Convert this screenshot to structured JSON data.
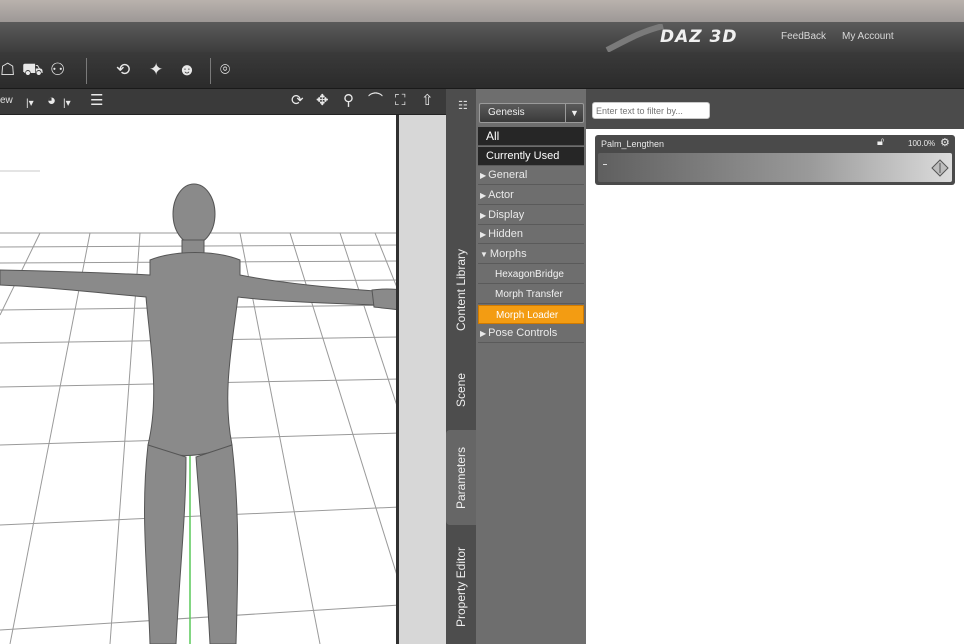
{
  "brand": {
    "logo": "DAZ 3D",
    "links": [
      "FeedBack",
      "My Account"
    ]
  },
  "viewport": {
    "view_label": "ew"
  },
  "side_tabs": [
    "Content Library",
    "Scene",
    "Parameters",
    "Property Editor"
  ],
  "active_side_tab": "Parameters",
  "figure_select": {
    "value": "Genesis",
    "arrow": "▼"
  },
  "filter": {
    "placeholder": "Enter text to filter by..."
  },
  "categories": {
    "all": "All",
    "currently_used": "Currently Used",
    "general": "General",
    "actor": "Actor",
    "display": "Display",
    "hidden": "Hidden",
    "morphs": "Morphs",
    "morphs_children": [
      "HexagonBridge",
      "Morph Transfer",
      "Morph Loader"
    ],
    "pose_controls": "Pose Controls"
  },
  "selected_category": "Morph Loader",
  "parameter": {
    "name": "Palm_Lengthen",
    "value_text": "100.0%",
    "value": 1.0,
    "min_marker": "-"
  },
  "colors": {
    "accent": "#f39c12",
    "panel_dark": "#262626",
    "panel_mid": "#6e6e6e",
    "toolbar": "#333333"
  },
  "icons": {
    "toolbar": [
      "figure-tool-icon",
      "pose-tool-icon",
      "group-tool-icon",
      "rotate-tool-icon",
      "light-tool-icon",
      "person-tool-icon",
      "camera-tool-icon"
    ],
    "viewport": [
      "display-style-icon",
      "sphere-icon",
      "list-icon",
      "orbit-icon",
      "pan-icon",
      "zoom-icon",
      "rotate-icon",
      "frame-icon",
      "up-icon"
    ]
  }
}
